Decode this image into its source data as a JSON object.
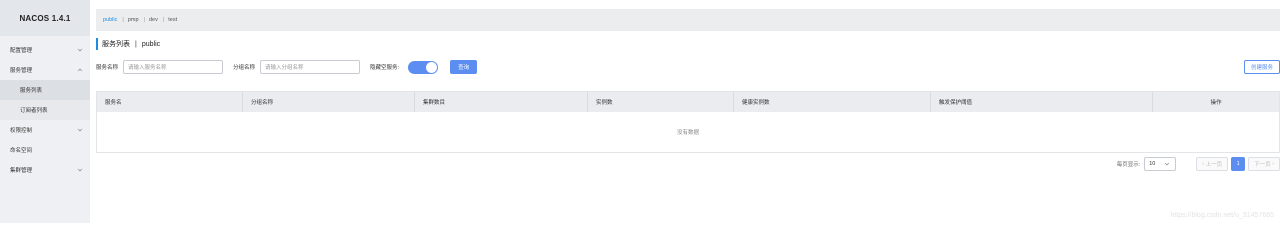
{
  "app": {
    "title": "NACOS 1.4.1"
  },
  "sidebar": {
    "items": [
      {
        "label": "配置管理",
        "has_chevron": true,
        "chevron": "down"
      },
      {
        "label": "服务管理",
        "has_chevron": true,
        "chevron": "up"
      },
      {
        "label": "服务列表",
        "sub": true,
        "active": true
      },
      {
        "label": "订阅者列表",
        "sub": true
      },
      {
        "label": "权限控制",
        "has_chevron": true,
        "chevron": "down"
      },
      {
        "label": "命名空间"
      },
      {
        "label": "集群管理",
        "has_chevron": true,
        "chevron": "down"
      }
    ]
  },
  "namespaces": [
    {
      "label": "public",
      "active": true
    },
    {
      "label": "pmp"
    },
    {
      "label": "dev"
    },
    {
      "label": "test"
    }
  ],
  "page": {
    "title": "服务列表",
    "namespace": "public",
    "separator": "|"
  },
  "filters": {
    "service_name_label": "服务名称",
    "service_name_placeholder": "请输入服务名称",
    "group_name_label": "分组名称",
    "group_name_placeholder": "请输入分组名称",
    "hide_empty_label": "隐藏空服务:",
    "hide_empty_on": true,
    "query_button": "查询",
    "create_button": "创建服务"
  },
  "table": {
    "columns": [
      "服务名",
      "分组名称",
      "集群数目",
      "实例数",
      "健康实例数",
      "触发保护阈值",
      "操作"
    ],
    "empty_text": "没有数据"
  },
  "pagination": {
    "page_size_label": "每页显示:",
    "page_size": "10",
    "prev": "上一页",
    "current_page": "1",
    "next": "下一页"
  },
  "watermark": "https://blog.csdn.net/u_31457665",
  "colors": {
    "accent": "#5b8ef0",
    "active_ns": "#1e8ce0"
  }
}
